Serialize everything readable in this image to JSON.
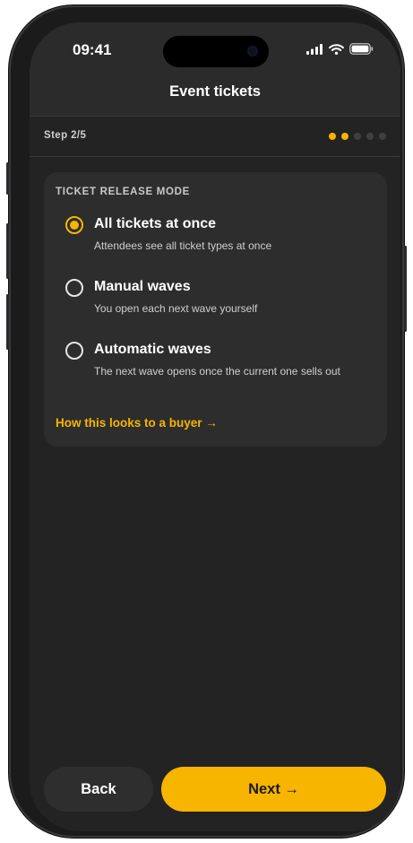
{
  "status": {
    "time": "09:41"
  },
  "header": {
    "title": "Event tickets"
  },
  "step": {
    "label": "Step 2/5",
    "current": 2,
    "total": 5
  },
  "release": {
    "heading": "TICKET RELEASE MODE",
    "options": [
      {
        "title": "All tickets at once",
        "desc": "Attendees see all ticket types at once",
        "selected": true
      },
      {
        "title": "Manual waves",
        "desc": "You open each next wave yourself",
        "selected": false
      },
      {
        "title": "Automatic waves",
        "desc": "The next wave opens once the current one sells out",
        "selected": false
      }
    ],
    "link": "How this looks to a buyer →"
  },
  "footer": {
    "back_label": "Back",
    "next_label": "Next →"
  },
  "colors": {
    "accent": "#f7b500",
    "background": "#232324",
    "card": "#2d2d2e"
  }
}
